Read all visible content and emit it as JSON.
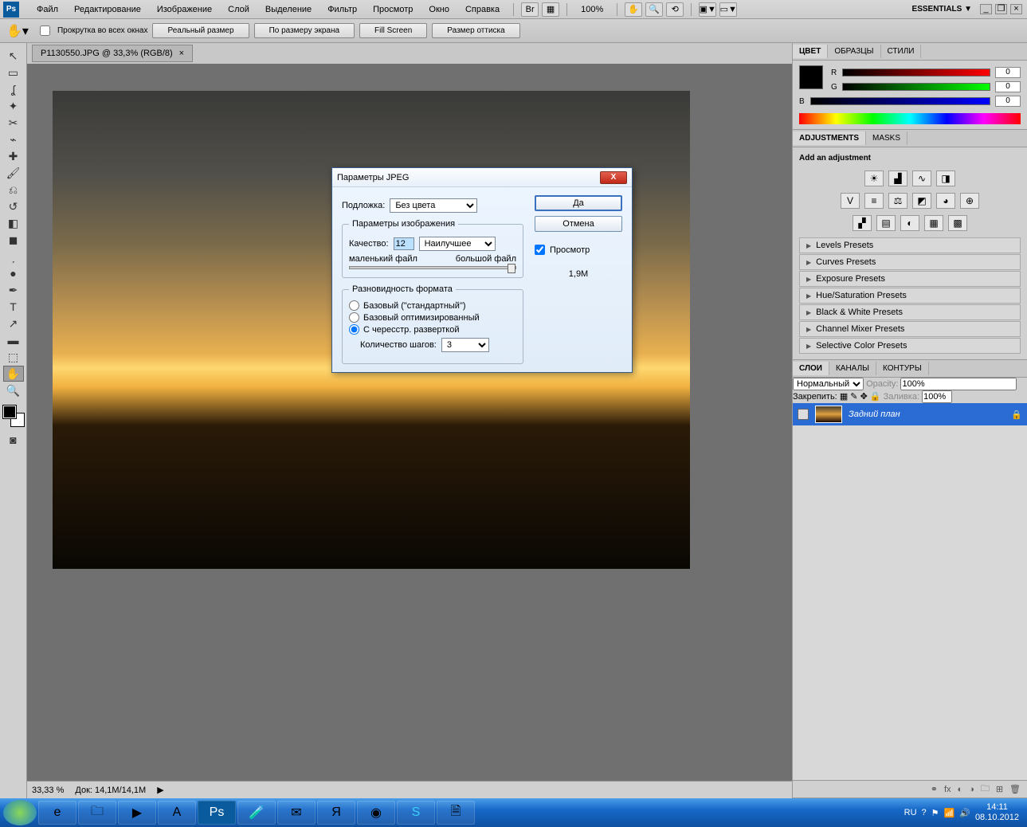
{
  "menu": {
    "file": "Файл",
    "edit": "Редактирование",
    "image": "Изображение",
    "layer": "Слой",
    "select": "Выделение",
    "filter": "Фильтр",
    "view": "Просмотр",
    "window": "Окно",
    "help": "Справка"
  },
  "zoom_menu": "100%",
  "workspace": "ESSENTIALS ▼",
  "optbar": {
    "scroll_all": "Прокрутка во всех окнах",
    "actual": "Реальный размер",
    "fit": "По размеру экрана",
    "fill": "Fill Screen",
    "print": "Размер оттиска"
  },
  "doc": {
    "title": "P1130550.JPG @ 33,3% (RGB/8)",
    "zoom": "33,33 %",
    "docinfo": "Док: 14,1M/14,1M"
  },
  "color": {
    "tab_color": "ЦВЕТ",
    "tab_swatch": "ОБРАЗЦЫ",
    "tab_styles": "СТИЛИ",
    "r": "R",
    "g": "G",
    "b": "B",
    "rv": "0",
    "gv": "0",
    "bv": "0"
  },
  "adj": {
    "tab_adj": "ADJUSTMENTS",
    "tab_masks": "MASKS",
    "title": "Add an adjustment",
    "presets": [
      "Levels Presets",
      "Curves Presets",
      "Exposure Presets",
      "Hue/Saturation Presets",
      "Black & White Presets",
      "Channel Mixer Presets",
      "Selective Color Presets"
    ]
  },
  "layers": {
    "tab_layers": "СЛОИ",
    "tab_channels": "КАНАЛЫ",
    "tab_paths": "КОНТУРЫ",
    "blend": "Нормальный",
    "opacity_l": "Opacity:",
    "opacity_v": "100%",
    "lock_l": "Закрепить:",
    "fill_l": "Заливка:",
    "fill_v": "100%",
    "bg": "Задний план"
  },
  "dialog": {
    "title": "Параметры JPEG",
    "matte": "Подложка:",
    "matte_v": "Без цвета",
    "ok": "Да",
    "cancel": "Отмена",
    "preview": "Просмотр",
    "size": "1,9M",
    "img_opts": "Параметры изображения",
    "quality": "Качество:",
    "quality_v": "12",
    "quality_sel": "Наилучшее",
    "small": "маленький файл",
    "large": "большой файл",
    "format": "Разновидность формата",
    "f1": "Базовый (\"стандартный\")",
    "f2": "Базовый оптимизированный",
    "f3": "С чересстр. разверткой",
    "scans": "Количество шагов:",
    "scans_v": "3"
  },
  "tray": {
    "lang": "RU",
    "time": "14:11",
    "date": "08.10.2012"
  }
}
